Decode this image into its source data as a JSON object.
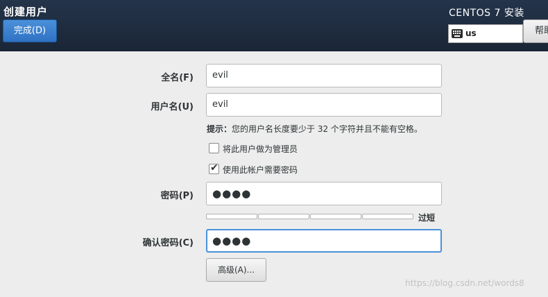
{
  "header": {
    "title": "创建用户",
    "done_button": "完成(D)",
    "product_title": "CENTOS 7 安装",
    "keyboard_layout": "us",
    "help_button": "帮助！"
  },
  "form": {
    "fullname_label": "全名(F)",
    "fullname_value": "evil",
    "username_label": "用户名(U)",
    "username_value": "evil",
    "hint_prefix": "提示：",
    "hint_text": "您的用户名长度要少于 32 个字符并且不能有空格。",
    "admin_checkbox_label": "将此用户做为管理员",
    "admin_checked": false,
    "require_password_label": "使用此帐户需要密码",
    "require_password_checked": true,
    "password_label": "密码(P)",
    "password_value": "●●●●",
    "strength_label": "过短",
    "strength_fraction": 0,
    "confirm_label": "确认密码(C)",
    "confirm_value": "●●●●",
    "advanced_button": "高级(A)..."
  },
  "watermark": "https://blog.csdn.net/words8",
  "colors": {
    "header_bg": "#1f2d40",
    "accent_blue": "#3b82d0",
    "page_bg": "#ededed"
  }
}
